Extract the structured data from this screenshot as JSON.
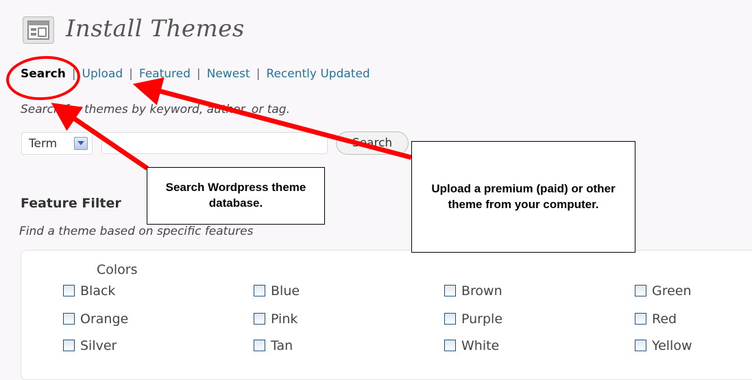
{
  "header": {
    "title": "Install Themes",
    "icon": "theme-layout-icon"
  },
  "subnav": {
    "items": [
      {
        "label": "Search",
        "current": true
      },
      {
        "label": "Upload",
        "current": false
      },
      {
        "label": "Featured",
        "current": false
      },
      {
        "label": "Newest",
        "current": false
      },
      {
        "label": "Recently Updated",
        "current": false
      }
    ],
    "separator": "|"
  },
  "search": {
    "hint": "Search for themes by keyword, author, or tag.",
    "type_select": "Term",
    "input_value": "",
    "button_label": "Search"
  },
  "feature_filter": {
    "title": "Feature Filter",
    "hint": "Find a theme based on specific features",
    "colors_label": "Colors",
    "colors": [
      [
        "Black",
        "Blue",
        "Brown",
        "Green"
      ],
      [
        "Orange",
        "Pink",
        "Purple",
        "Red"
      ],
      [
        "Silver",
        "Tan",
        "White",
        "Yellow"
      ]
    ]
  },
  "annotations": {
    "search_callout": [
      "Search Wordpress theme",
      "database."
    ],
    "upload_callout": [
      "Upload a premium (paid) or other",
      "theme from your computer."
    ],
    "highlight_color": "#ff0000"
  }
}
